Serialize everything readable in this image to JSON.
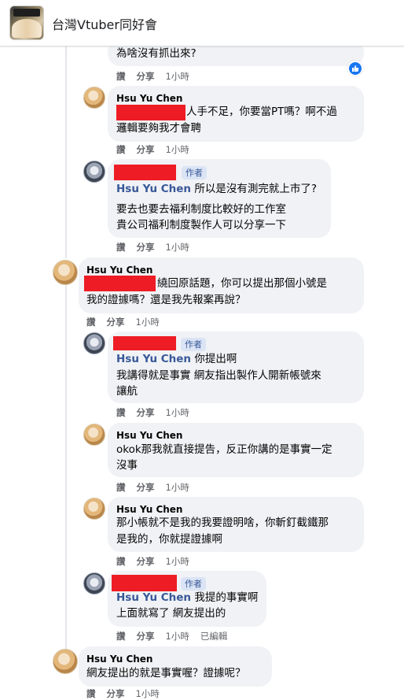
{
  "group": {
    "title": "台灣Vtuber同好會"
  },
  "comments": [
    {
      "id": "c0",
      "text_lines": [
        "為啥沒有抓出來?"
      ],
      "actions": [
        "讚",
        "分享",
        "1小時"
      ]
    },
    {
      "id": "c1",
      "name": "Hsu Yu Chen",
      "text_lines": [
        "人手不足，你要當PT嗎？啊不過",
        "邏輯要夠我才會聘"
      ],
      "actions": [
        "讚",
        "分享",
        "1小時"
      ]
    },
    {
      "id": "c2",
      "badge": "作者",
      "tag": "Hsu Yu Chen",
      "text_lines": [
        "所以是沒有測完就上市了?",
        "要去也要去福利制度比較好的工作室",
        "貴公司福利制度製作人可以分享一下"
      ],
      "actions": [
        "讚",
        "分享",
        "1小時"
      ]
    },
    {
      "id": "c3",
      "name": "Hsu Yu Chen",
      "text_lines": [
        "繞回原話題，你可以提出那個小號是",
        "我的證據嗎？還是我先報案再說？"
      ],
      "actions": [
        "讚",
        "分享",
        "1小時"
      ]
    },
    {
      "id": "c4",
      "badge": "作者",
      "tag": "Hsu Yu Chen",
      "text_lines": [
        "你提出啊",
        "我講得就是事實 網友指出製作人開新帳號來",
        "讓航"
      ],
      "actions": [
        "讚",
        "分享",
        "1小時"
      ]
    },
    {
      "id": "c5",
      "name": "Hsu Yu Chen",
      "text_lines": [
        "okok那我就直接提告，反正你講的是事實一定",
        "沒事"
      ],
      "actions": [
        "讚",
        "分享",
        "1小時"
      ]
    },
    {
      "id": "c6",
      "name": "Hsu Yu Chen",
      "text_lines": [
        "那小帳就不是我的我要證明啥，你斬釘截鐵那",
        "是我的，你就提證據啊"
      ],
      "actions": [
        "讚",
        "分享",
        "1小時"
      ]
    },
    {
      "id": "c7",
      "badge": "作者",
      "tag": "Hsu Yu Chen",
      "text_lines": [
        "我提的事實啊",
        "上面就寫了 網友提出的"
      ],
      "actions": [
        "讚",
        "分享",
        "1小時",
        "已編輯"
      ]
    },
    {
      "id": "c8",
      "name": "Hsu Yu Chen",
      "text_lines": [
        "網友提出的就是事實喔？證據呢？"
      ],
      "actions": [
        "讚",
        "分享",
        "1小時"
      ]
    }
  ],
  "colors": {
    "redaction": "#ee1c24",
    "like": "#1877f2",
    "bubble": "#f0f2f5"
  },
  "icons": {
    "like": "thumbs-up-icon"
  }
}
